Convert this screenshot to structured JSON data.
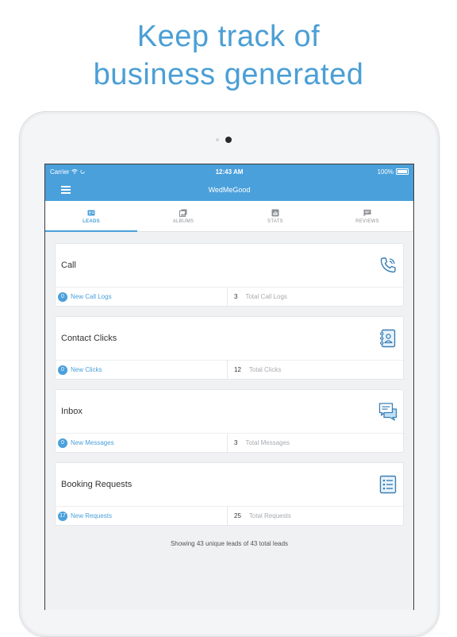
{
  "headline": {
    "line1": "Keep track of",
    "line2": "business generated"
  },
  "status_bar": {
    "carrier": "Carrier",
    "time": "12:43 AM",
    "battery": "100%"
  },
  "nav": {
    "title": "WedMeGood"
  },
  "tabs": [
    {
      "label": "LEADS",
      "icon": "contact-card-icon",
      "active": true
    },
    {
      "label": "ALBUMS",
      "icon": "albums-icon",
      "active": false
    },
    {
      "label": "STATS",
      "icon": "stats-icon",
      "active": false
    },
    {
      "label": "REVIEWS",
      "icon": "chat-bubble-icon",
      "active": false
    }
  ],
  "cards": [
    {
      "title": "Call",
      "icon": "phone-icon",
      "new_count": "0",
      "new_label": "New Call Logs",
      "total_count": "3",
      "total_label": "Total Call Logs"
    },
    {
      "title": "Contact Clicks",
      "icon": "address-book-icon",
      "new_count": "0",
      "new_label": "New Clicks",
      "total_count": "12",
      "total_label": "Total Clicks"
    },
    {
      "title": "Inbox",
      "icon": "message-icon",
      "new_count": "0",
      "new_label": "New Messages",
      "total_count": "3",
      "total_label": "Total Messages"
    },
    {
      "title": "Booking Requests",
      "icon": "checklist-icon",
      "new_count": "17",
      "new_label": "New Requests",
      "total_count": "25",
      "total_label": "Total Requests"
    }
  ],
  "summary": "Showing 43 unique leads of 43 total leads",
  "colors": {
    "accent": "#4aa0db",
    "headline": "#4b9fd5",
    "icon_stroke": "#3a7fb5"
  }
}
